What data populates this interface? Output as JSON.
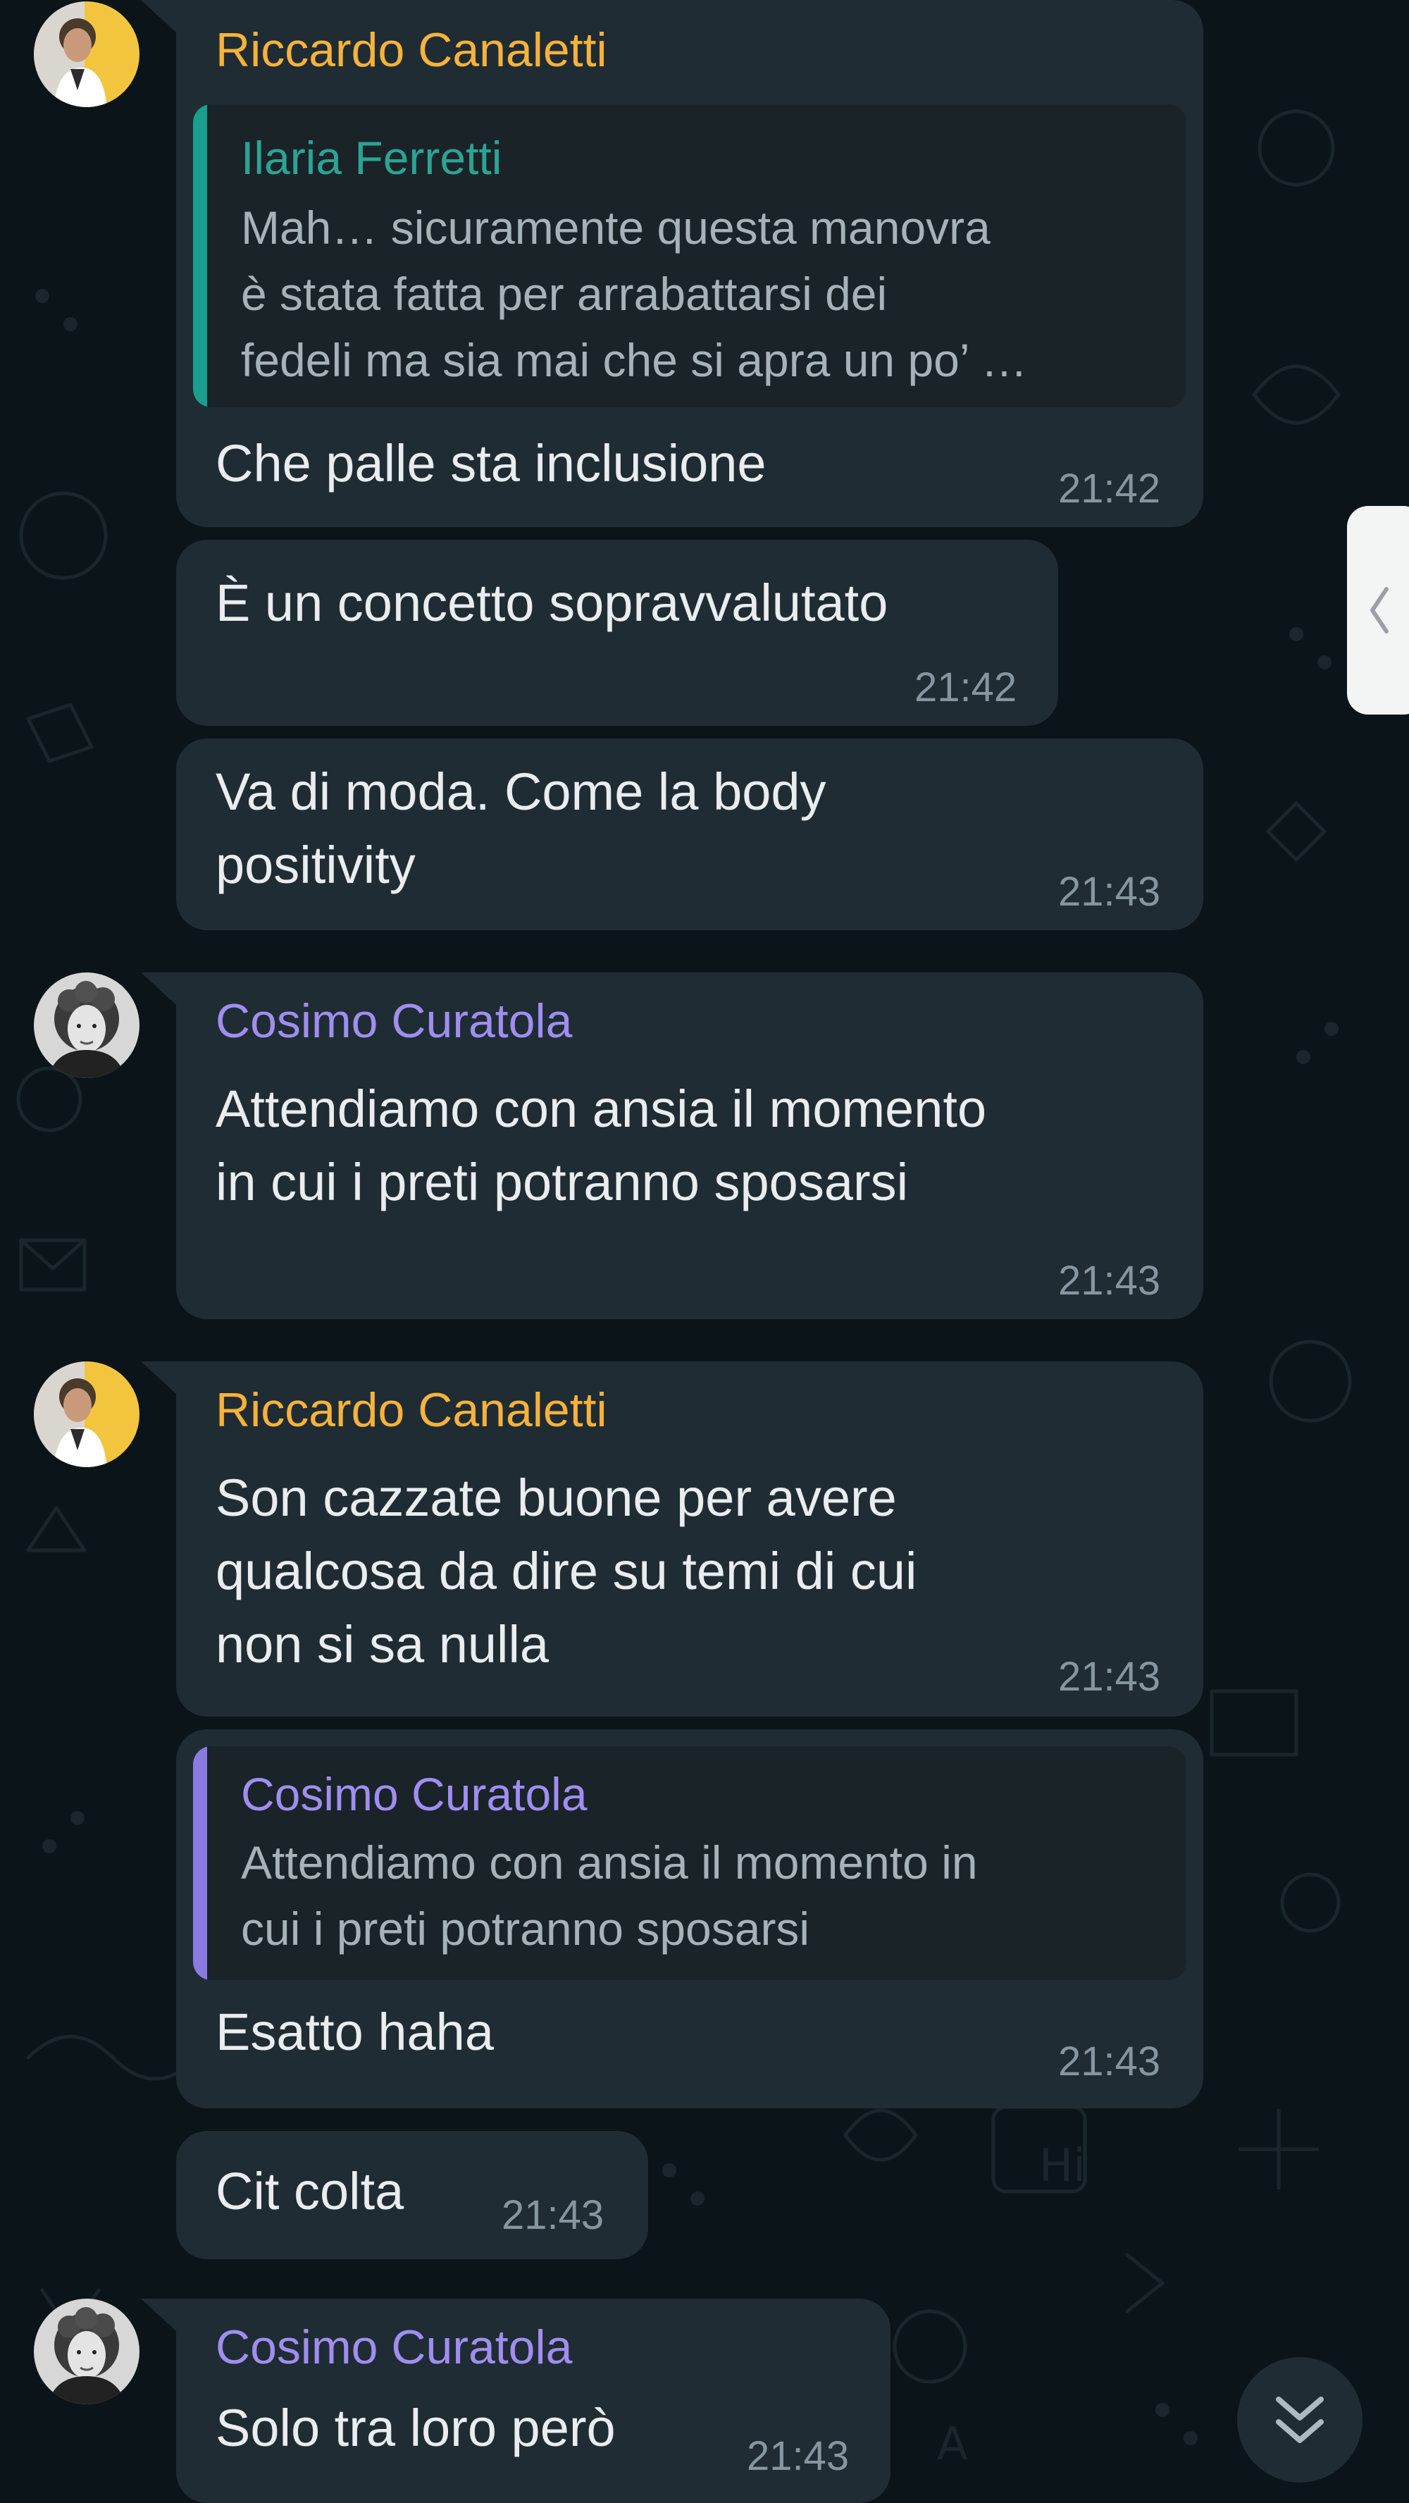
{
  "colors": {
    "chat_background": "#0b1419",
    "bubble": "#202c33",
    "quote_background": "#1a2328",
    "text": "#e9edef",
    "timestamp": "#8696a0",
    "riccardo_name": "#f7b23b",
    "cosimo_name": "#9f8ef0",
    "ilaria_name": "#2ba495",
    "ilaria_quote_bar": "#1a9e8e",
    "cosimo_quote_bar": "#8a7be3"
  },
  "avatars": [
    {
      "name": "riccardo-avatar",
      "icon": "person-photo-yellow-bg"
    },
    {
      "name": "cosimo-avatar",
      "icon": "person-photo-curly-hair"
    },
    {
      "name": "riccardo-avatar",
      "icon": "person-photo-yellow-bg"
    },
    {
      "name": "cosimo-avatar",
      "icon": "person-photo-curly-hair"
    }
  ],
  "messages": [
    {
      "sender": "Riccardo Canaletti",
      "quote": {
        "sender": "Ilaria Ferretti",
        "text": "Mah… sicuramente questa manovra\nè stata fatta per arrabattarsi dei\nfedeli ma sia mai che si apra un po’ …"
      },
      "text": "Che palle sta inclusione",
      "time": "21:42"
    },
    {
      "text": "È un concetto sopravvalutato",
      "time": "21:42"
    },
    {
      "text": "Va di moda. Come la body\npositivity",
      "time": "21:43"
    },
    {
      "sender": "Cosimo Curatola",
      "text": "Attendiamo con ansia il momento\nin cui i preti potranno sposarsi",
      "time": "21:43"
    },
    {
      "sender": "Riccardo Canaletti",
      "text": "Son cazzate buone per avere\nqualcosa da dire su temi di cui\nnon si sa nulla",
      "time": "21:43"
    },
    {
      "quote": {
        "sender": "Cosimo Curatola",
        "text": "Attendiamo con ansia il momento in\ncui i preti potranno sposarsi"
      },
      "text": "Esatto haha",
      "time": "21:43"
    },
    {
      "text": "Cit colta",
      "time": "21:43"
    },
    {
      "sender": "Cosimo Curatola",
      "text": "Solo tra loro però",
      "time": "21:43"
    }
  ],
  "controls": {
    "side_handle_icon": "chevron-left-icon",
    "scroll_down_icon": "double-chevron-down-icon"
  }
}
